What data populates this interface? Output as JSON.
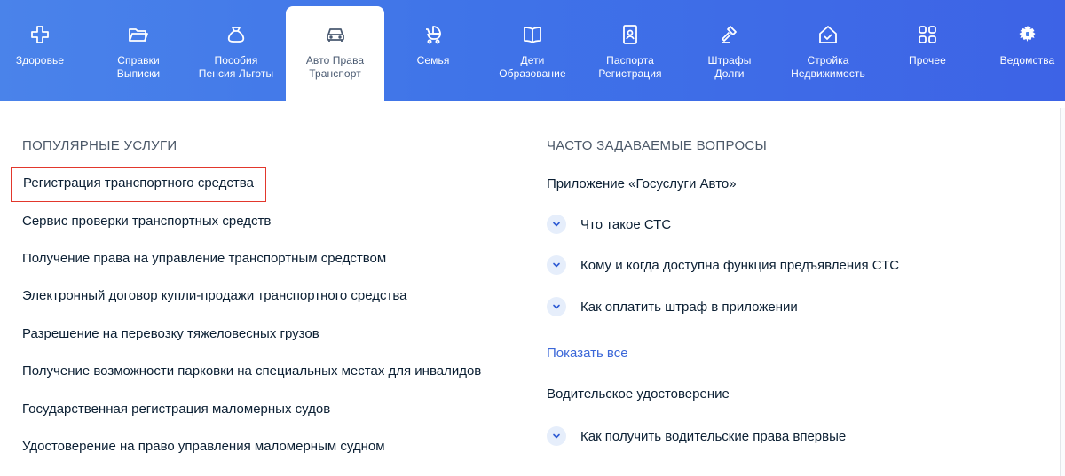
{
  "categories": [
    {
      "id": "health",
      "label": "Здоровье",
      "icon": "cross-icon",
      "active": false
    },
    {
      "id": "certificates",
      "label": "Справки\nВыписки",
      "icon": "folder-icon",
      "active": false
    },
    {
      "id": "benefits",
      "label": "Пособия\nПенсия Льготы",
      "icon": "moneybag-icon",
      "active": false
    },
    {
      "id": "auto",
      "label": "Авто Права\nТранспорт",
      "icon": "car-icon",
      "active": true
    },
    {
      "id": "family",
      "label": "Семья",
      "icon": "stroller-icon",
      "active": false
    },
    {
      "id": "children",
      "label": "Дети\nОбразование",
      "icon": "book-icon",
      "active": false
    },
    {
      "id": "passports",
      "label": "Паспорта\nРегистрация",
      "icon": "passport-icon",
      "active": false
    },
    {
      "id": "fines",
      "label": "Штрафы\nДолги",
      "icon": "gavel-icon",
      "active": false
    },
    {
      "id": "construction",
      "label": "Стройка\nНедвижимость",
      "icon": "house-icon",
      "active": false
    },
    {
      "id": "other",
      "label": "Прочее",
      "icon": "grid-icon",
      "active": false
    },
    {
      "id": "agencies",
      "label": "Ведомства",
      "icon": "emblem-icon",
      "active": false
    }
  ],
  "popular": {
    "title": "ПОПУЛЯРНЫЕ УСЛУГИ",
    "items": [
      "Регистрация транспортного средства",
      "Сервис проверки транспортных средств",
      "Получение права на управление транспортным средством",
      "Электронный договор купли-продажи транспортного средства",
      "Разрешение на перевозку тяжеловесных грузов",
      "Получение возможности парковки на специальных местах для инвалидов",
      "Государственная регистрация маломерных судов",
      "Удостоверение на право управления маломерным судном"
    ]
  },
  "faq": {
    "title": "ЧАСТО ЗАДАВАЕМЫЕ ВОПРОСЫ",
    "group1": "Приложение «Госуслуги Авто»",
    "group1_items": [
      "Что такое СТС",
      "Кому и когда доступна функция предъявления СТС",
      "Как оплатить штраф в приложении"
    ],
    "show_all": "Показать все",
    "group2": "Водительское удостоверение",
    "group2_items": [
      "Как получить водительские права впервые"
    ]
  },
  "colors": {
    "topbar": "#3f73e8",
    "highlight_border": "#e2372c",
    "link": "#3b67d8"
  }
}
